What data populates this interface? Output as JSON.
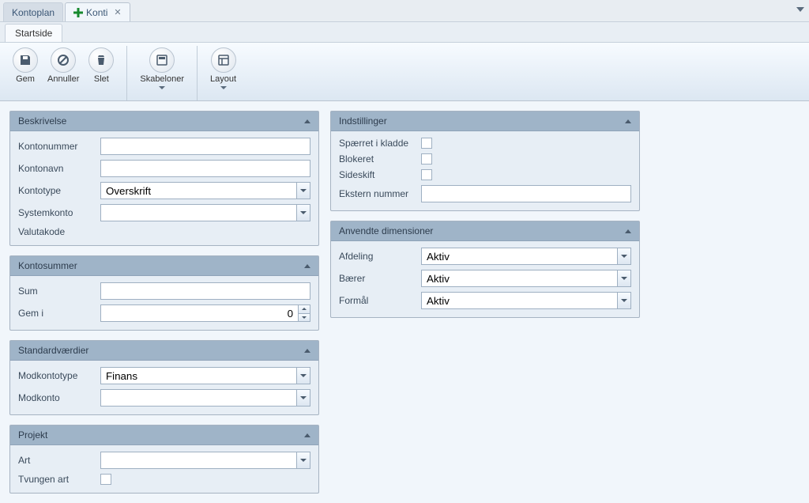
{
  "tabs": {
    "items": [
      {
        "label": "Kontoplan",
        "active": false
      },
      {
        "label": "Konti",
        "active": true
      }
    ]
  },
  "subtab": {
    "label": "Startside"
  },
  "toolbar": {
    "gem": "Gem",
    "annuller": "Annuller",
    "slet": "Slet",
    "skabeloner": "Skabeloner",
    "layout": "Layout"
  },
  "panels": {
    "beskrivelse": {
      "title": "Beskrivelse",
      "kontonummer_label": "Kontonummer",
      "kontonummer_value": "",
      "kontonavn_label": "Kontonavn",
      "kontonavn_value": "",
      "kontotype_label": "Kontotype",
      "kontotype_value": "Overskrift",
      "systemkonto_label": "Systemkonto",
      "systemkonto_value": "",
      "valutakode_label": "Valutakode"
    },
    "kontosummer": {
      "title": "Kontosummer",
      "sum_label": "Sum",
      "sum_value": "",
      "gem_i_label": "Gem i",
      "gem_i_value": "0"
    },
    "standardvaerdier": {
      "title": "Standardværdier",
      "modkontotype_label": "Modkontotype",
      "modkontotype_value": "Finans",
      "modkonto_label": "Modkonto",
      "modkonto_value": ""
    },
    "projekt": {
      "title": "Projekt",
      "art_label": "Art",
      "art_value": "",
      "tvungen_art_label": "Tvungen art",
      "tvungen_art_checked": false
    },
    "indstillinger": {
      "title": "Indstillinger",
      "spaerret_label": "Spærret i kladde",
      "spaerret_checked": false,
      "blokeret_label": "Blokeret",
      "blokeret_checked": false,
      "sideskift_label": "Sideskift",
      "sideskift_checked": false,
      "ekstern_label": "Ekstern nummer",
      "ekstern_value": ""
    },
    "anvendte": {
      "title": "Anvendte dimensioner",
      "afdeling_label": "Afdeling",
      "afdeling_value": "Aktiv",
      "baerer_label": "Bærer",
      "baerer_value": "Aktiv",
      "formaal_label": "Formål",
      "formaal_value": "Aktiv"
    }
  }
}
